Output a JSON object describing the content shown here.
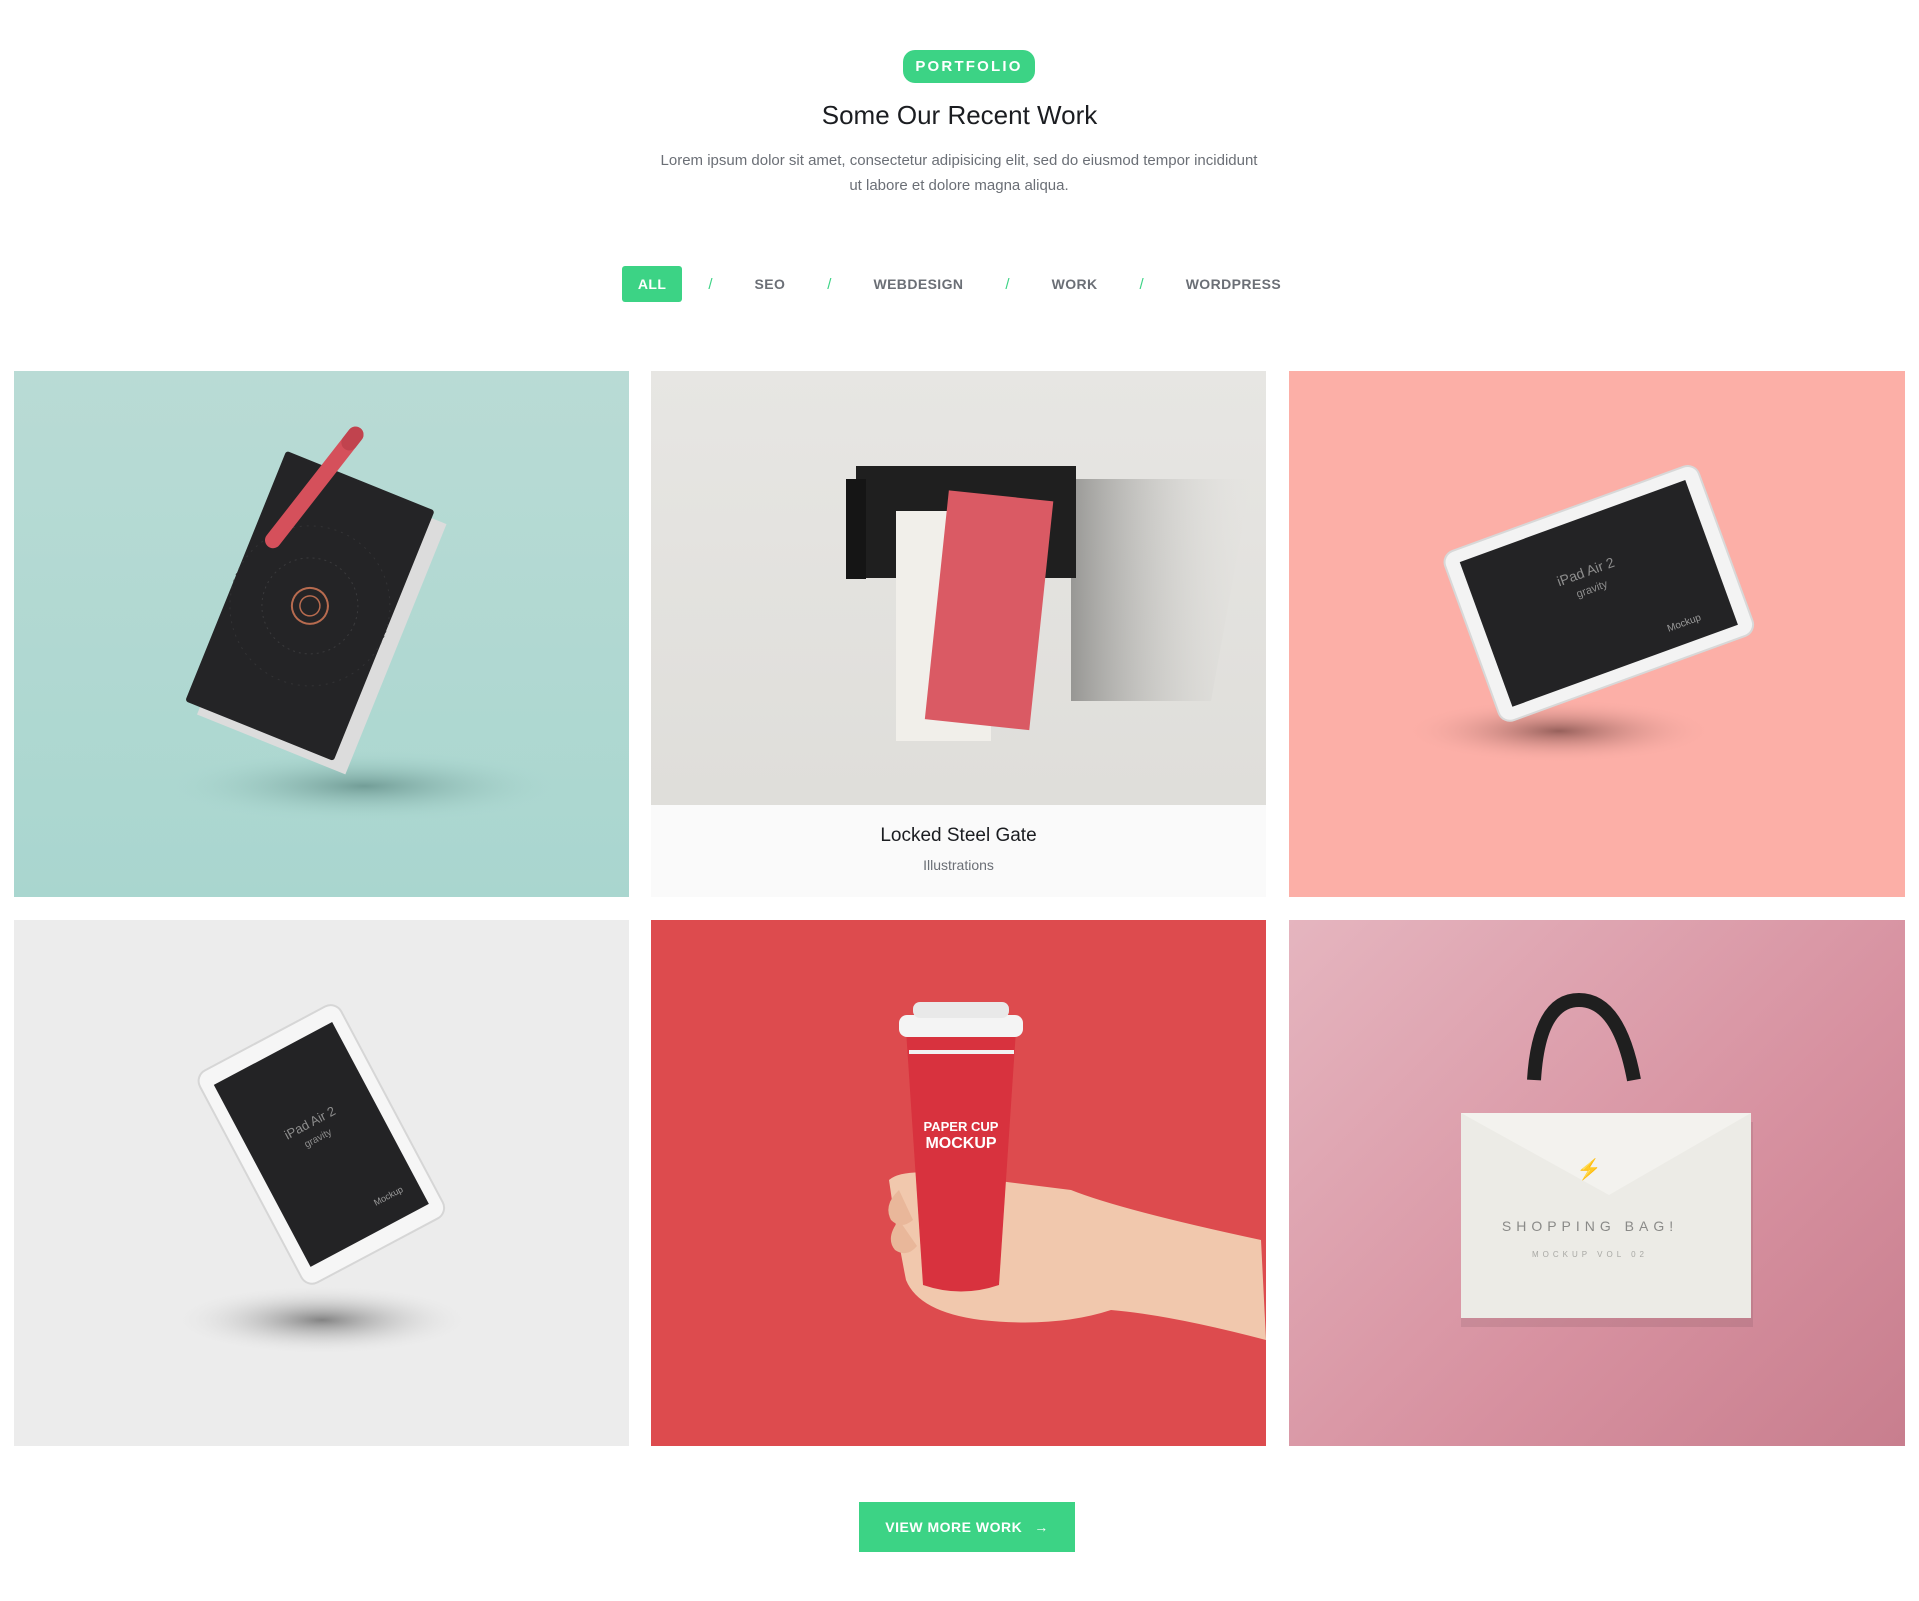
{
  "section": {
    "badge": "PORTFOLIO",
    "title": "Some Our Recent Work",
    "subtitle": "Lorem ipsum dolor sit amet, consectetur adipisicing elit, sed do eiusmod tempor incididunt ut labore et dolore magna aliqua."
  },
  "filters": {
    "items": [
      "ALL",
      "SEO",
      "WEBDESIGN",
      "WORK",
      "WORDPRESS"
    ],
    "separator": "/",
    "active": "ALL"
  },
  "portfolio": {
    "items": [
      {
        "art": "notebook-with-pen-mockup",
        "color": "#b9dbd5"
      },
      {
        "art": "paper-letter-mockup",
        "color": "#e4e3e0",
        "title": "Locked Steel Gate",
        "category": "Illustrations"
      },
      {
        "art": "ipad-landscape-mockup",
        "color": "#fcafa7",
        "screen_title": "iPad Air 2",
        "screen_sub": "gravity",
        "screen_label": "Mockup"
      },
      {
        "art": "ipad-portrait-mockup",
        "color": "#ececec",
        "screen_title": "iPad Air 2",
        "screen_sub": "gravity",
        "screen_label": "Mockup"
      },
      {
        "art": "paper-cup-mockup",
        "color": "#dd4b4e",
        "cup_text_1": "PAPER CUP",
        "cup_text_2": "MOCKUP"
      },
      {
        "art": "shopping-bag-mockup",
        "color": "#d99aa8",
        "bag_text": "SHOPPING BAG!",
        "bag_sub": "MOCKUP VOL 02"
      }
    ]
  },
  "cta": {
    "label": "VIEW MORE WORK",
    "icon": "arrow-right-icon"
  },
  "colors": {
    "accent": "#3cd385",
    "text": "#1b1d21",
    "muted": "#6b6f76"
  }
}
